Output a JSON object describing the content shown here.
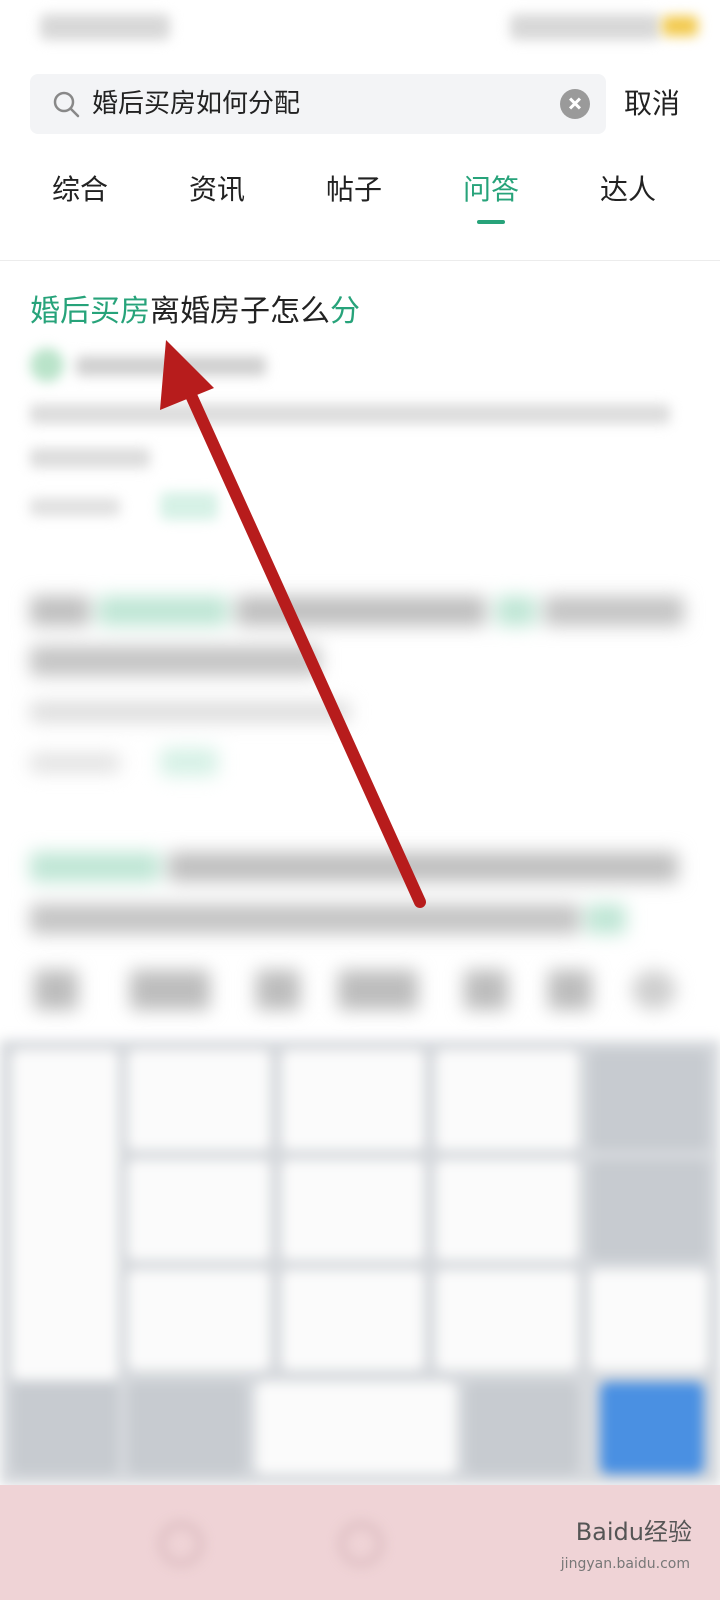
{
  "search": {
    "query": "婚后买房如何分配",
    "cancel_label": "取消"
  },
  "tabs": [
    {
      "label": "综合",
      "active": false
    },
    {
      "label": "资讯",
      "active": false
    },
    {
      "label": "帖子",
      "active": false
    },
    {
      "label": "问答",
      "active": true
    },
    {
      "label": "达人",
      "active": false
    }
  ],
  "results": [
    {
      "title_parts": [
        "婚后买房",
        "离婚房子怎么",
        "分"
      ],
      "highlight_color": "#27a37a"
    }
  ],
  "colors": {
    "accent": "#27a37a",
    "arrow": "#b71c1c"
  },
  "watermark": {
    "brand": "Baidu经验",
    "url": "jingyan.baidu.com"
  }
}
